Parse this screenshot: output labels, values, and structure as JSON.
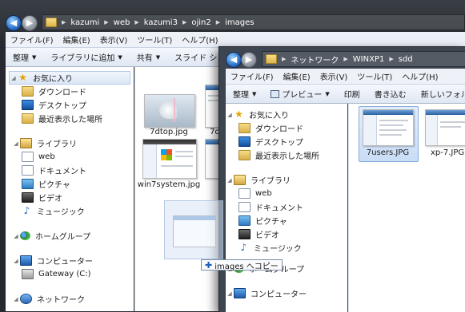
{
  "back_window": {
    "address": [
      "kazumi",
      "web",
      "kazumi3",
      "ojin2",
      "images"
    ],
    "menu": [
      "ファイル(F)",
      "編集(E)",
      "表示(V)",
      "ツール(T)",
      "ヘルプ(H)"
    ],
    "commands": [
      "整理",
      "ライブラリに追加",
      "共有",
      "スライド ショー"
    ],
    "nav": {
      "favorites": "お気に入り",
      "favorite_items": [
        "ダウンロード",
        "デスクトップ",
        "最近表示した場所"
      ],
      "libraries": "ライブラリ",
      "library_items": [
        "web",
        "ドキュメント",
        "ピクチャ",
        "ビデオ",
        "ミュージック"
      ],
      "homegroup": "ホームグループ",
      "computer": "コンピューター",
      "drive": "Gateway (C:)",
      "network": "ネットワーク"
    },
    "files": [
      "7dtop.jpg",
      "7c",
      "win7system.jpg"
    ]
  },
  "front_window": {
    "address": [
      "ネットワーク",
      "WINXP1",
      "sdd"
    ],
    "menu": [
      "ファイル(F)",
      "編集(E)",
      "表示(V)",
      "ツール(T)",
      "ヘルプ(H)"
    ],
    "commands": [
      "整理",
      "プレビュー",
      "印刷",
      "書き込む",
      "新しいフォルダー"
    ],
    "nav": {
      "favorites": "お気に入り",
      "favorite_items": [
        "ダウンロード",
        "デスクトップ",
        "最近表示した場所"
      ],
      "libraries": "ライブラリ",
      "library_items": [
        "web",
        "ドキュメント",
        "ピクチャ",
        "ビデオ",
        "ミュージック"
      ],
      "homegroup": "ホームグループ",
      "computer": "コンピューター"
    },
    "files": [
      "7users.JPG",
      "xp-7.JPG"
    ]
  },
  "drag_tooltip": "images へコピー"
}
